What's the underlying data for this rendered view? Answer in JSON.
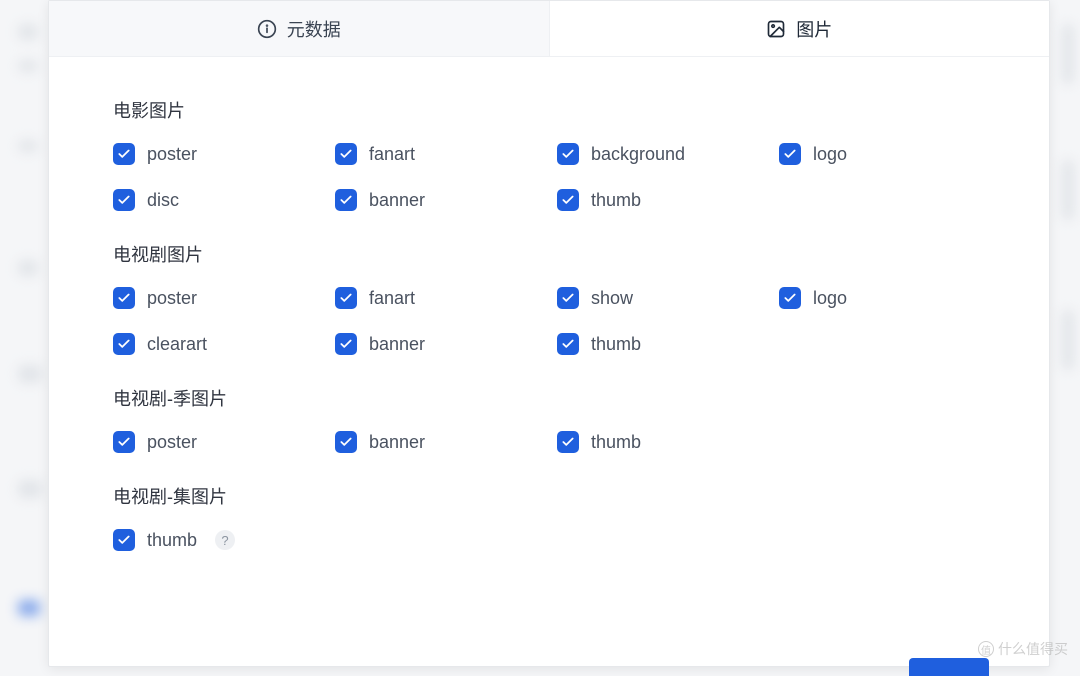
{
  "tabs": {
    "metadata": {
      "label": "元数据"
    },
    "images": {
      "label": "图片"
    }
  },
  "sections": {
    "movie": {
      "title": "电影图片",
      "items": [
        {
          "label": "poster",
          "checked": true
        },
        {
          "label": "fanart",
          "checked": true
        },
        {
          "label": "background",
          "checked": true
        },
        {
          "label": "logo",
          "checked": true
        },
        {
          "label": "disc",
          "checked": true
        },
        {
          "label": "banner",
          "checked": true
        },
        {
          "label": "thumb",
          "checked": true
        }
      ]
    },
    "tv": {
      "title": "电视剧图片",
      "items": [
        {
          "label": "poster",
          "checked": true
        },
        {
          "label": "fanart",
          "checked": true
        },
        {
          "label": "show",
          "checked": true
        },
        {
          "label": "logo",
          "checked": true
        },
        {
          "label": "clearart",
          "checked": true
        },
        {
          "label": "banner",
          "checked": true
        },
        {
          "label": "thumb",
          "checked": true
        }
      ]
    },
    "tv_season": {
      "title": "电视剧-季图片",
      "items": [
        {
          "label": "poster",
          "checked": true
        },
        {
          "label": "banner",
          "checked": true
        },
        {
          "label": "thumb",
          "checked": true
        }
      ]
    },
    "tv_episode": {
      "title": "电视剧-集图片",
      "items": [
        {
          "label": "thumb",
          "checked": true,
          "help": true
        }
      ]
    }
  },
  "help_symbol": "?",
  "watermark": "什么值得买"
}
